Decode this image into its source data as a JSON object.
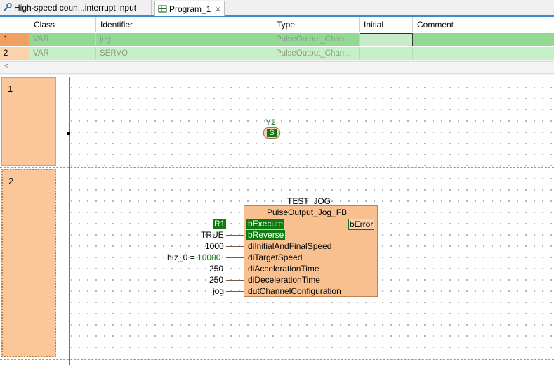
{
  "tabs": [
    {
      "label": "High-speed coun...interrupt input",
      "icon": "wrench-icon"
    },
    {
      "label": "Program_1",
      "icon": "ladder-program-icon",
      "close": "×"
    }
  ],
  "vartable": {
    "columns": [
      "Class",
      "Identifier",
      "Type",
      "Initial",
      "Comment"
    ],
    "rows": [
      {
        "num": "1",
        "class": "VAR",
        "identifier": "jog",
        "type": "PulseOutput_Chan...",
        "initial": "",
        "comment": ""
      },
      {
        "num": "2",
        "class": "VAR",
        "identifier": "SERVO",
        "type": "PulseOutput_Chan...",
        "initial": "",
        "comment": ""
      }
    ],
    "scroll_left": "<"
  },
  "rungs": [
    {
      "number": "1",
      "coil": {
        "label": "Y2",
        "symbol": "S"
      }
    },
    {
      "number": "2",
      "fb": {
        "instance": "TEST_JOG",
        "type": "PulseOutput_Jog_FB",
        "inputs": [
          {
            "name": "bExecute",
            "value": "R1"
          },
          {
            "name": "bReverse",
            "value": "TRUE"
          },
          {
            "name": "diInitialAndFinalSpeed",
            "value": "1000"
          },
          {
            "name": "diTargetSpeed",
            "value": "10000",
            "prefix": "hız_0 ="
          },
          {
            "name": "diAccelerationTime",
            "value": "250"
          },
          {
            "name": "diDecelerationTime",
            "value": "250"
          },
          {
            "name": "dutChannelConfiguration",
            "value": "jog"
          }
        ],
        "outputs": [
          {
            "name": "bError"
          }
        ]
      }
    }
  ],
  "colors": {
    "accent": "#3c8ad6",
    "rung_header": "#fbc79a",
    "fb_body": "#f9c08f",
    "highlight": "#0e7a10",
    "row_green": "#93d993"
  }
}
